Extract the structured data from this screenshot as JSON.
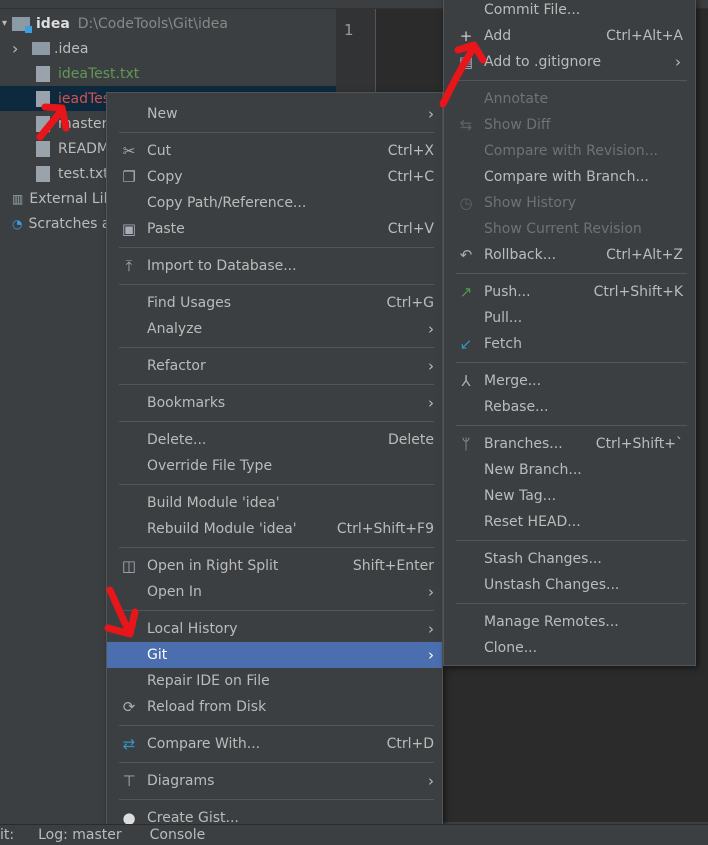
{
  "project_tree": {
    "root": {
      "label": "idea",
      "path": "D:\\CodeTools\\Git\\idea"
    },
    "items": [
      {
        "label": ".idea",
        "type": "folder",
        "color": "#bbbbbb",
        "icon": "folder-icon"
      },
      {
        "label": "ideaTest.txt",
        "type": "file",
        "color": "#629755",
        "icon": "text-file-icon"
      },
      {
        "label": "ieadTest.txt",
        "type": "file",
        "color": "#d25252",
        "icon": "text-file-icon",
        "selected": true
      },
      {
        "label": "master.txt",
        "type": "file",
        "color": "#bbbbbb",
        "icon": "text-file-icon"
      },
      {
        "label": "README.md",
        "type": "file",
        "color": "#bbbbbb",
        "icon": "markdown-file-icon"
      },
      {
        "label": "test.txt",
        "type": "file",
        "color": "#bbbbbb",
        "icon": "text-file-icon"
      }
    ],
    "external": "External Libraries",
    "scratches": "Scratches and Consoles"
  },
  "editor": {
    "line_number": "1"
  },
  "status_bar": {
    "git_label": "it:",
    "log": "Log: master",
    "console": "Console"
  },
  "context_menu": [
    {
      "label": "New",
      "submenu": true
    },
    {
      "sep": true
    },
    {
      "label": "Cut",
      "shortcut": "Ctrl+X",
      "icon": "scissors-icon"
    },
    {
      "label": "Copy",
      "shortcut": "Ctrl+C",
      "icon": "copy-icon"
    },
    {
      "label": "Copy Path/Reference..."
    },
    {
      "label": "Paste",
      "shortcut": "Ctrl+V",
      "icon": "clipboard-icon"
    },
    {
      "sep": true
    },
    {
      "label": "Import to Database...",
      "icon": "import-icon"
    },
    {
      "sep": true
    },
    {
      "label": "Find Usages",
      "shortcut": "Ctrl+G"
    },
    {
      "label": "Analyze",
      "submenu": true
    },
    {
      "sep": true
    },
    {
      "label": "Refactor",
      "submenu": true
    },
    {
      "sep": true
    },
    {
      "label": "Bookmarks",
      "submenu": true
    },
    {
      "sep": true
    },
    {
      "label": "Delete...",
      "shortcut": "Delete"
    },
    {
      "label": "Override File Type"
    },
    {
      "sep": true
    },
    {
      "label": "Build Module 'idea'"
    },
    {
      "label": "Rebuild Module 'idea'",
      "shortcut": "Ctrl+Shift+F9"
    },
    {
      "sep": true
    },
    {
      "label": "Open in Right Split",
      "shortcut": "Shift+Enter",
      "icon": "split-icon"
    },
    {
      "label": "Open In",
      "submenu": true
    },
    {
      "sep": true
    },
    {
      "label": "Local History",
      "submenu": true
    },
    {
      "label": "Git",
      "submenu": true,
      "selected": true
    },
    {
      "label": "Repair IDE on File"
    },
    {
      "label": "Reload from Disk",
      "icon": "reload-icon"
    },
    {
      "sep": true
    },
    {
      "label": "Compare With...",
      "shortcut": "Ctrl+D",
      "icon": "compare-icon"
    },
    {
      "sep": true
    },
    {
      "label": "Diagrams",
      "submenu": true,
      "icon": "diagram-icon"
    },
    {
      "sep": true
    },
    {
      "label": "Create Gist...",
      "icon": "github-icon"
    }
  ],
  "git_menu": [
    {
      "label": "Commit File..."
    },
    {
      "label": "Add",
      "shortcut": "Ctrl+Alt+A",
      "icon": "plus-icon"
    },
    {
      "label": "Add to .gitignore",
      "submenu": true,
      "icon": "gitignore-icon"
    },
    {
      "sep": true
    },
    {
      "label": "Annotate",
      "disabled": true
    },
    {
      "label": "Show Diff",
      "disabled": true,
      "icon": "diff-icon"
    },
    {
      "label": "Compare with Revision...",
      "disabled": true
    },
    {
      "label": "Compare with Branch..."
    },
    {
      "label": "Show History",
      "disabled": true,
      "icon": "clock-icon"
    },
    {
      "label": "Show Current Revision",
      "disabled": true
    },
    {
      "label": "Rollback...",
      "shortcut": "Ctrl+Alt+Z",
      "icon": "undo-icon"
    },
    {
      "sep": true
    },
    {
      "label": "Push...",
      "shortcut": "Ctrl+Shift+K",
      "icon": "push-arrow-icon"
    },
    {
      "label": "Pull..."
    },
    {
      "label": "Fetch",
      "icon": "fetch-icon"
    },
    {
      "sep": true
    },
    {
      "label": "Merge...",
      "icon": "merge-icon"
    },
    {
      "label": "Rebase..."
    },
    {
      "sep": true
    },
    {
      "label": "Branches...",
      "shortcut": "Ctrl+Shift+`",
      "icon": "branch-icon"
    },
    {
      "label": "New Branch..."
    },
    {
      "label": "New Tag..."
    },
    {
      "label": "Reset HEAD..."
    },
    {
      "sep": true
    },
    {
      "label": "Stash Changes..."
    },
    {
      "label": "Unstash Changes..."
    },
    {
      "sep": true
    },
    {
      "label": "Manage Remotes..."
    },
    {
      "label": "Clone..."
    }
  ],
  "icon_glyphs": {
    "scissors-icon": "✂",
    "copy-icon": "❐",
    "clipboard-icon": "▣",
    "import-icon": "⤒",
    "split-icon": "◫",
    "reload-icon": "⟳",
    "compare-icon": "⇄",
    "diagram-icon": "⊤",
    "github-icon": "●",
    "plus-icon": "+",
    "gitignore-icon": "▤",
    "diff-icon": "⇆",
    "clock-icon": "◷",
    "undo-icon": "↶",
    "push-arrow-icon": "↗",
    "fetch-icon": "↙",
    "merge-icon": "⅄",
    "branch-icon": "ᛘ"
  },
  "icon_colors": {
    "push-arrow-icon": "#499c54",
    "fetch-icon": "#3592c4",
    "compare-icon": "#3592c4",
    "github-icon": "#dddddd",
    "plus-icon": "#cccccc"
  },
  "colors": {
    "menu_bg": "#3c3f41",
    "selection": "#4b6eaf",
    "tree_selection": "#0d293e",
    "annotation": "#e8161a"
  }
}
